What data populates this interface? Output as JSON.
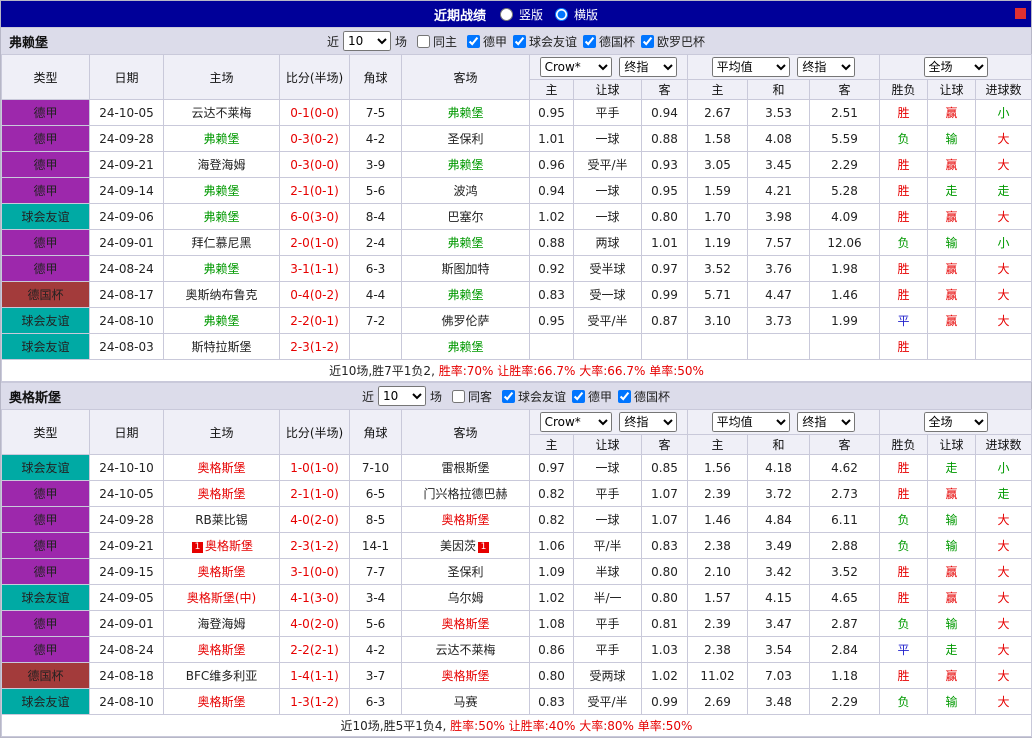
{
  "topbar": {
    "title": "近期战绩",
    "radios": [
      {
        "label": "竖版",
        "checked": false
      },
      {
        "label": "横版",
        "checked": true
      }
    ]
  },
  "filter_labels": {
    "near": "近",
    "matches": "场"
  },
  "dropdowns": {
    "recent": "10",
    "odds_source": "Crow*",
    "odds_time": "终指",
    "avg_source": "平均值",
    "avg_time": "终指",
    "scope": "全场"
  },
  "table_headers": [
    "类型",
    "日期",
    "主场",
    "比分(半场)",
    "角球",
    "客场"
  ],
  "sub_headers": [
    "主",
    "让球",
    "客",
    "主",
    "和",
    "客",
    "胜负",
    "让球",
    "进球数"
  ],
  "colors": {
    "topbar_bg": "#000099",
    "band_bg": "#dcdcea",
    "header_bg": "#efeff7",
    "border": "#c9c9da",
    "score": "#e60000",
    "league": {
      "德甲": "#9d28ac",
      "球会友谊": "#00aaa4",
      "德国杯": "#a33b3b"
    },
    "result": {
      "胜": "#e60000",
      "赢": "#e60000",
      "大": "#e60000",
      "负": "#009900",
      "输": "#009900",
      "小": "#009900",
      "走": "#009900",
      "平": "#2222cc"
    }
  },
  "sections": [
    {
      "team": "弗赖堡",
      "focus_color": "#009900",
      "filter": {
        "same_label": "同主",
        "same_checked": false,
        "leagues": [
          {
            "label": "德甲",
            "checked": true
          },
          {
            "label": "球会友谊",
            "checked": true
          },
          {
            "label": "德国杯",
            "checked": true
          },
          {
            "label": "欧罗巴杯",
            "checked": true
          }
        ]
      },
      "rows": [
        {
          "league": "德甲",
          "date": "24-10-05",
          "home": "云达不莱梅",
          "home_focus": false,
          "home_badge": "",
          "score": "0-1(0-0)",
          "corner": "7-5",
          "away": "弗赖堡",
          "away_focus": true,
          "away_badge": "",
          "odds_home": "0.95",
          "handicap": "平手",
          "odds_away": "0.94",
          "avg_home": "2.67",
          "avg_draw": "3.53",
          "avg_away": "2.51",
          "result_wdl": "胜",
          "result_handicap": "赢",
          "result_goals": "小"
        },
        {
          "league": "德甲",
          "date": "24-09-28",
          "home": "弗赖堡",
          "home_focus": true,
          "home_badge": "",
          "score": "0-3(0-2)",
          "corner": "4-2",
          "away": "圣保利",
          "away_focus": false,
          "away_badge": "",
          "odds_home": "1.01",
          "handicap": "一球",
          "odds_away": "0.88",
          "avg_home": "1.58",
          "avg_draw": "4.08",
          "avg_away": "5.59",
          "result_wdl": "负",
          "result_handicap": "输",
          "result_goals": "大"
        },
        {
          "league": "德甲",
          "date": "24-09-21",
          "home": "海登海姆",
          "home_focus": false,
          "home_badge": "",
          "score": "0-3(0-0)",
          "corner": "3-9",
          "away": "弗赖堡",
          "away_focus": true,
          "away_badge": "",
          "odds_home": "0.96",
          "handicap": "受平/半",
          "odds_away": "0.93",
          "avg_home": "3.05",
          "avg_draw": "3.45",
          "avg_away": "2.29",
          "result_wdl": "胜",
          "result_handicap": "赢",
          "result_goals": "大"
        },
        {
          "league": "德甲",
          "date": "24-09-14",
          "home": "弗赖堡",
          "home_focus": true,
          "home_badge": "",
          "score": "2-1(0-1)",
          "corner": "5-6",
          "away": "波鸿",
          "away_focus": false,
          "away_badge": "",
          "odds_home": "0.94",
          "handicap": "一球",
          "odds_away": "0.95",
          "avg_home": "1.59",
          "avg_draw": "4.21",
          "avg_away": "5.28",
          "result_wdl": "胜",
          "result_handicap": "走",
          "result_goals": "走"
        },
        {
          "league": "球会友谊",
          "date": "24-09-06",
          "home": "弗赖堡",
          "home_focus": true,
          "home_badge": "",
          "score": "6-0(3-0)",
          "corner": "8-4",
          "away": "巴塞尔",
          "away_focus": false,
          "away_badge": "",
          "odds_home": "1.02",
          "handicap": "一球",
          "odds_away": "0.80",
          "avg_home": "1.70",
          "avg_draw": "3.98",
          "avg_away": "4.09",
          "result_wdl": "胜",
          "result_handicap": "赢",
          "result_goals": "大"
        },
        {
          "league": "德甲",
          "date": "24-09-01",
          "home": "拜仁慕尼黑",
          "home_focus": false,
          "home_badge": "",
          "score": "2-0(1-0)",
          "corner": "2-4",
          "away": "弗赖堡",
          "away_focus": true,
          "away_badge": "",
          "odds_home": "0.88",
          "handicap": "两球",
          "odds_away": "1.01",
          "avg_home": "1.19",
          "avg_draw": "7.57",
          "avg_away": "12.06",
          "result_wdl": "负",
          "result_handicap": "输",
          "result_goals": "小"
        },
        {
          "league": "德甲",
          "date": "24-08-24",
          "home": "弗赖堡",
          "home_focus": true,
          "home_badge": "",
          "score": "3-1(1-1)",
          "corner": "6-3",
          "away": "斯图加特",
          "away_focus": false,
          "away_badge": "",
          "odds_home": "0.92",
          "handicap": "受半球",
          "odds_away": "0.97",
          "avg_home": "3.52",
          "avg_draw": "3.76",
          "avg_away": "1.98",
          "result_wdl": "胜",
          "result_handicap": "赢",
          "result_goals": "大"
        },
        {
          "league": "德国杯",
          "date": "24-08-17",
          "home": "奥斯纳布鲁克",
          "home_focus": false,
          "home_badge": "",
          "score": "0-4(0-2)",
          "corner": "4-4",
          "away": "弗赖堡",
          "away_focus": true,
          "away_badge": "",
          "odds_home": "0.83",
          "handicap": "受一球",
          "odds_away": "0.99",
          "avg_home": "5.71",
          "avg_draw": "4.47",
          "avg_away": "1.46",
          "result_wdl": "胜",
          "result_handicap": "赢",
          "result_goals": "大"
        },
        {
          "league": "球会友谊",
          "date": "24-08-10",
          "home": "弗赖堡",
          "home_focus": true,
          "home_badge": "",
          "score": "2-2(0-1)",
          "corner": "7-2",
          "away": "佛罗伦萨",
          "away_focus": false,
          "away_badge": "",
          "odds_home": "0.95",
          "handicap": "受平/半",
          "odds_away": "0.87",
          "avg_home": "3.10",
          "avg_draw": "3.73",
          "avg_away": "1.99",
          "result_wdl": "平",
          "result_handicap": "赢",
          "result_goals": "大"
        },
        {
          "league": "球会友谊",
          "date": "24-08-03",
          "home": "斯特拉斯堡",
          "home_focus": false,
          "home_badge": "",
          "score": "2-3(1-2)",
          "corner": "",
          "away": "弗赖堡",
          "away_focus": true,
          "away_badge": "",
          "odds_home": "",
          "handicap": "",
          "odds_away": "",
          "avg_home": "",
          "avg_draw": "",
          "avg_away": "",
          "result_wdl": "胜",
          "result_handicap": "",
          "result_goals": ""
        }
      ],
      "summary_prefix": "近10场,胜7平1负2,",
      "summary_stats": "胜率:70% 让胜率:66.7% 大率:66.7% 单率:50%"
    },
    {
      "team": "奥格斯堡",
      "focus_color": "#e60000",
      "filter": {
        "same_label": "同客",
        "same_checked": false,
        "leagues": [
          {
            "label": "球会友谊",
            "checked": true
          },
          {
            "label": "德甲",
            "checked": true
          },
          {
            "label": "德国杯",
            "checked": true
          }
        ]
      },
      "rows": [
        {
          "league": "球会友谊",
          "date": "24-10-10",
          "home": "奥格斯堡",
          "home_focus": true,
          "home_badge": "",
          "score": "1-0(1-0)",
          "corner": "7-10",
          "away": "雷根斯堡",
          "away_focus": false,
          "away_badge": "",
          "odds_home": "0.97",
          "handicap": "一球",
          "odds_away": "0.85",
          "avg_home": "1.56",
          "avg_draw": "4.18",
          "avg_away": "4.62",
          "result_wdl": "胜",
          "result_handicap": "走",
          "result_goals": "小"
        },
        {
          "league": "德甲",
          "date": "24-10-05",
          "home": "奥格斯堡",
          "home_focus": true,
          "home_badge": "",
          "score": "2-1(1-0)",
          "corner": "6-5",
          "away": "门兴格拉德巴赫",
          "away_focus": false,
          "away_badge": "",
          "odds_home": "0.82",
          "handicap": "平手",
          "odds_away": "1.07",
          "avg_home": "2.39",
          "avg_draw": "3.72",
          "avg_away": "2.73",
          "result_wdl": "胜",
          "result_handicap": "赢",
          "result_goals": "走"
        },
        {
          "league": "德甲",
          "date": "24-09-28",
          "home": "RB莱比锡",
          "home_focus": false,
          "home_badge": "",
          "score": "4-0(2-0)",
          "corner": "8-5",
          "away": "奥格斯堡",
          "away_focus": true,
          "away_badge": "",
          "odds_home": "0.82",
          "handicap": "一球",
          "odds_away": "1.07",
          "avg_home": "1.46",
          "avg_draw": "4.84",
          "avg_away": "6.11",
          "result_wdl": "负",
          "result_handicap": "输",
          "result_goals": "大"
        },
        {
          "league": "德甲",
          "date": "24-09-21",
          "home": "奥格斯堡",
          "home_focus": true,
          "home_badge": "1",
          "score": "2-3(1-2)",
          "corner": "14-1",
          "away": "美因茨",
          "away_focus": false,
          "away_badge": "1",
          "odds_home": "1.06",
          "handicap": "平/半",
          "odds_away": "0.83",
          "avg_home": "2.38",
          "avg_draw": "3.49",
          "avg_away": "2.88",
          "result_wdl": "负",
          "result_handicap": "输",
          "result_goals": "大"
        },
        {
          "league": "德甲",
          "date": "24-09-15",
          "home": "奥格斯堡",
          "home_focus": true,
          "home_badge": "",
          "score": "3-1(0-0)",
          "corner": "7-7",
          "away": "圣保利",
          "away_focus": false,
          "away_badge": "",
          "odds_home": "1.09",
          "handicap": "半球",
          "odds_away": "0.80",
          "avg_home": "2.10",
          "avg_draw": "3.42",
          "avg_away": "3.52",
          "result_wdl": "胜",
          "result_handicap": "赢",
          "result_goals": "大"
        },
        {
          "league": "球会友谊",
          "date": "24-09-05",
          "home": "奥格斯堡(中)",
          "home_focus": true,
          "home_badge": "",
          "score": "4-1(3-0)",
          "corner": "3-4",
          "away": "乌尔姆",
          "away_focus": false,
          "away_badge": "",
          "odds_home": "1.02",
          "handicap": "半/一",
          "odds_away": "0.80",
          "avg_home": "1.57",
          "avg_draw": "4.15",
          "avg_away": "4.65",
          "result_wdl": "胜",
          "result_handicap": "赢",
          "result_goals": "大"
        },
        {
          "league": "德甲",
          "date": "24-09-01",
          "home": "海登海姆",
          "home_focus": false,
          "home_badge": "",
          "score": "4-0(2-0)",
          "corner": "5-6",
          "away": "奥格斯堡",
          "away_focus": true,
          "away_badge": "",
          "odds_home": "1.08",
          "handicap": "平手",
          "odds_away": "0.81",
          "avg_home": "2.39",
          "avg_draw": "3.47",
          "avg_away": "2.87",
          "result_wdl": "负",
          "result_handicap": "输",
          "result_goals": "大"
        },
        {
          "league": "德甲",
          "date": "24-08-24",
          "home": "奥格斯堡",
          "home_focus": true,
          "home_badge": "",
          "score": "2-2(2-1)",
          "corner": "4-2",
          "away": "云达不莱梅",
          "away_focus": false,
          "away_badge": "",
          "odds_home": "0.86",
          "handicap": "平手",
          "odds_away": "1.03",
          "avg_home": "2.38",
          "avg_draw": "3.54",
          "avg_away": "2.84",
          "result_wdl": "平",
          "result_handicap": "走",
          "result_goals": "大"
        },
        {
          "league": "德国杯",
          "date": "24-08-18",
          "home": "BFC维多利亚",
          "home_focus": false,
          "home_badge": "",
          "score": "1-4(1-1)",
          "corner": "3-7",
          "away": "奥格斯堡",
          "away_focus": true,
          "away_badge": "",
          "odds_home": "0.80",
          "handicap": "受两球",
          "odds_away": "1.02",
          "avg_home": "11.02",
          "avg_draw": "7.03",
          "avg_away": "1.18",
          "result_wdl": "胜",
          "result_handicap": "赢",
          "result_goals": "大"
        },
        {
          "league": "球会友谊",
          "date": "24-08-10",
          "home": "奥格斯堡",
          "home_focus": true,
          "home_badge": "",
          "score": "1-3(1-2)",
          "corner": "6-3",
          "away": "马赛",
          "away_focus": false,
          "away_badge": "",
          "odds_home": "0.83",
          "handicap": "受平/半",
          "odds_away": "0.99",
          "avg_home": "2.69",
          "avg_draw": "3.48",
          "avg_away": "2.29",
          "result_wdl": "负",
          "result_handicap": "输",
          "result_goals": "大"
        }
      ],
      "summary_prefix": "近10场,胜5平1负4,",
      "summary_stats": "胜率:50% 让胜率:40% 大率:80% 单率:50%"
    }
  ]
}
